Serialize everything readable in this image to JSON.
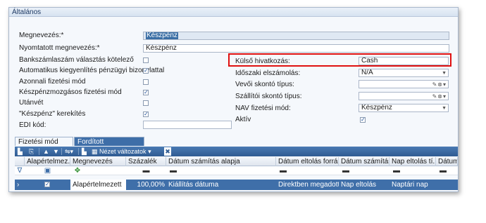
{
  "group": {
    "title": "Általános"
  },
  "fields": {
    "megnevezes": {
      "label": "Megnevezés:*",
      "value": "Készpénz"
    },
    "nyomtatott": {
      "label": "Nyomtatott megnevezés:*",
      "value": "Készpénz"
    },
    "bankszamla": {
      "label": "Bankszámlaszám választás kötelező",
      "checked": false
    },
    "automatikus": {
      "label": "Automatikus kiegyenlítés pénzügyi bizonylattal",
      "checked": true
    },
    "azonnali": {
      "label": "Azonnali fizetési mód",
      "checked": false
    },
    "keszpenzmozgasos": {
      "label": "Készpénzmozgásos fizetési mód",
      "checked": true
    },
    "utanvet": {
      "label": "Utánvét",
      "checked": false
    },
    "kerekites": {
      "label": "\"Készpénz\" kerekítés",
      "checked": true
    },
    "edi": {
      "label": "EDI kód:",
      "value": ""
    },
    "kulso": {
      "label": "Külső hivatkozás:",
      "value": "Cash"
    },
    "idoszaki": {
      "label": "Időszaki elszámolás:",
      "value": "N/A"
    },
    "vevoi": {
      "label": "Vevői skontó típus:",
      "value": ""
    },
    "szallitoi": {
      "label": "Szállítói skontó típus:",
      "value": ""
    },
    "nav": {
      "label": "NAV fizetési mód:",
      "value": "Készpénz"
    },
    "aktiv": {
      "label": "Aktív",
      "checked": true
    }
  },
  "tabs": [
    {
      "label": "Fizetési mód sorok",
      "active": true
    },
    {
      "label": "Fordított tulajdonságok",
      "active": false
    }
  ],
  "toolbar": {
    "view_label": "Nézet változatok"
  },
  "grid": {
    "columns": [
      "Alapértelmez...",
      "Megnevezés",
      "Százalék",
      "Dátum számítás alapja",
      "Dátum eltolás forrása",
      "Dátum számítás...",
      "Nap eltolás tí...",
      "Dátum e"
    ],
    "rows": [
      {
        "checked": true,
        "megnevezes": "Alapértelmezett",
        "szazalek": "100,00%",
        "datum_alap": "Kiállítás dátuma",
        "eltolas_forras": "Direktben megadott",
        "datum_szamitas": "Nap eltolás",
        "nap_eltolas": "Naptári nap",
        "datum_e": ""
      }
    ]
  },
  "colors": {
    "accent": "#3f6fa9",
    "highlight_border": "#e01010"
  }
}
